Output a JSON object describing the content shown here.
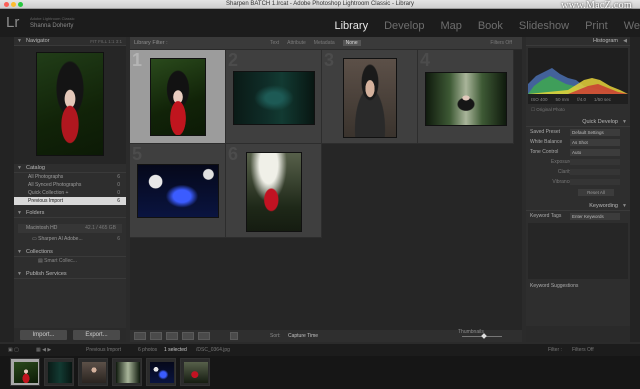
{
  "window": {
    "title": "Sharpen BATCH 1.lrcat - Adobe Photoshop Lightroom Classic - Library",
    "watermark": "www.MacZ.com"
  },
  "identity": {
    "logo": "Lr",
    "line1": "Adobe Lightroom Classic",
    "line2": "Shanna Doherty"
  },
  "modules": [
    "Library",
    "Develop",
    "Map",
    "Book",
    "Slideshow",
    "Print",
    "We"
  ],
  "left_panel": {
    "navigator": {
      "title": "Navigator",
      "opts": "FIT  FILL  1:1  3:1"
    },
    "catalog": {
      "title": "Catalog",
      "items": [
        {
          "label": "All Photographs",
          "count": "6"
        },
        {
          "label": "All Synced Photographs",
          "count": "0"
        },
        {
          "label": "Quick Collection +",
          "count": "0"
        },
        {
          "label": "Previous Import",
          "count": "6"
        }
      ]
    },
    "folders": {
      "title": "Folders",
      "volume": {
        "label": "Macintosh HD",
        "count": "42.1 / 465 GB"
      },
      "folder": {
        "label": "Sharpen AI Adobe...",
        "count": "6"
      }
    },
    "collections": {
      "title": "Collections",
      "item": "Smart Collec..."
    },
    "publish": {
      "title": "Publish Services"
    },
    "import_label": "Import...",
    "export_label": "Export..."
  },
  "center": {
    "filter_title": "Library Filter :",
    "filter_tabs": [
      "Text",
      "Attribute",
      "Metadata",
      "None"
    ],
    "filter_right": "Filters Off",
    "cells": [
      {
        "num": "1"
      },
      {
        "num": "2"
      },
      {
        "num": "3"
      },
      {
        "num": "4"
      },
      {
        "num": "5"
      },
      {
        "num": "6"
      }
    ],
    "sort_label": "Sort:",
    "sort_value": "Capture Time",
    "thumbnails_label": "Thumbnails"
  },
  "right_panel": {
    "histogram": {
      "title": "Histogram",
      "iso": "ISO 400",
      "focal": "50 mm",
      "aperture": "f/4.0",
      "shutter": "1/50 sec",
      "original": "Original Photo"
    },
    "quick_develop": {
      "title": "Quick Develop",
      "saved_preset_label": "Saved Preset",
      "saved_preset_value": "Default Settings",
      "white_balance_label": "White Balance",
      "white_balance_value": "As Shot",
      "tone_control_label": "Tone Control",
      "tone_control_value": "Auto",
      "exposure_label": "Exposure",
      "clarity_label": "Clarity",
      "vibrance_label": "Vibrance",
      "reset_label": "Reset All"
    },
    "keywording": {
      "title": "Keywording",
      "tags_label": "Keyword Tags",
      "tags_value": "Enter Keywords"
    },
    "keyword_suggestions": "Keyword Suggestions"
  },
  "filmstrip": {
    "source": "Previous Import",
    "photo_count": "6 photos",
    "selected": "1 selected",
    "filename": "/DSC_0364.jpg",
    "filter_label": "Filter :",
    "filter_value": "Filters Off"
  }
}
